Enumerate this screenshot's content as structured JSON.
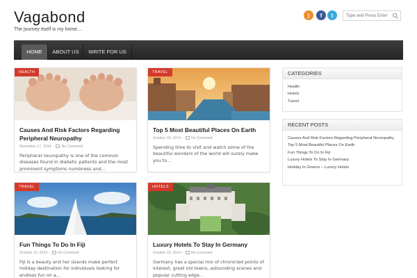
{
  "site": {
    "title": "Vagabond",
    "tagline": "The journey itself is my home...."
  },
  "header": {
    "social": [
      {
        "name": "rss-icon",
        "glyph": ")",
        "color": "#f08c2a"
      },
      {
        "name": "facebook-icon",
        "glyph": "f",
        "color": "#3b5998"
      },
      {
        "name": "twitter-icon",
        "glyph": "t",
        "color": "#39a8e0"
      }
    ],
    "search_placeholder": "Type and Press Enter"
  },
  "nav": {
    "items": [
      {
        "label": "HOME",
        "active": true
      },
      {
        "label": "ABOUT US",
        "active": false
      },
      {
        "label": "WRITE FOR US",
        "active": false
      }
    ]
  },
  "posts": [
    {
      "category": "HEALTH",
      "title": "Causes And Risk Factors Regarding Peripheral Neuropathy",
      "date": "November 17, 2014",
      "comments": "No Comment",
      "excerpt": "Peripheral neuropathy is one of the common diseases found in diabetic patients and the most prominent symptoms numbness and..."
    },
    {
      "category": "TRAVEL",
      "title": "Top 5 Most Beautiful Places On Earth",
      "date": "October 24, 2014",
      "comments": "No Comment",
      "excerpt": "Spending time to visit and watch some of the beautiful wonders of the world will surely make you to..."
    },
    {
      "category": "TRAVEL",
      "title": "Fun Things To Do In Fiji",
      "date": "October 15, 2014",
      "comments": "No Comment",
      "excerpt": "Fiji is a beauty and her islands make perfect holiday destination for individuals looking for endless fun on a..."
    },
    {
      "category": "HOTELS",
      "title": "Luxury Hotels To Stay In Germany",
      "date": "October 15, 2014",
      "comments": "No Comment",
      "excerpt": "Germany has a special mix of chronicled points of interest, great old towns, astounding scenes and popular cutting edge..."
    }
  ],
  "sidebar": {
    "categories": {
      "title": "CATEGORIES",
      "items": [
        "Health",
        "Hotels",
        "Travel"
      ]
    },
    "recent": {
      "title": "RECENT POSTS",
      "items": [
        "Causes And Risk Factors Regarding Peripheral Neuropathy",
        "Top 5 Most Beautiful Places On Earth",
        "Fun Things To Do In Fiji",
        "Luxury Hotels To Stay In Germany",
        "Holiday In Greece – Luxury Hotels"
      ]
    }
  },
  "colors": {
    "accent": "#d33a2c",
    "nav_bg": "#2e2e2e"
  }
}
